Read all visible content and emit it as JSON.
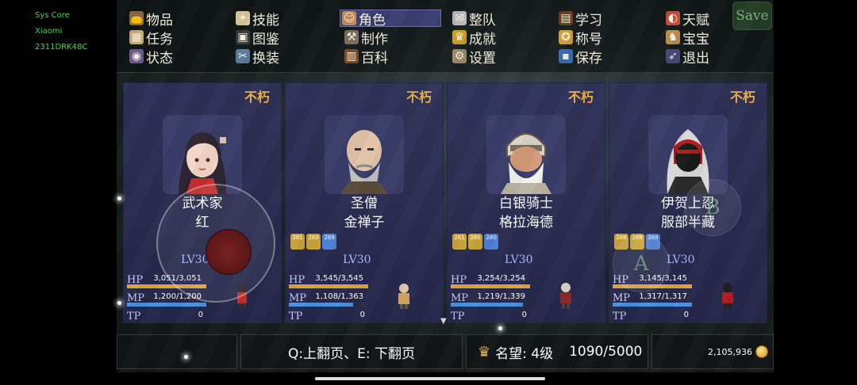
{
  "system": {
    "line1": "Sys Core",
    "line2": "Xiaomi",
    "line3": "2311DRK48C"
  },
  "menu": {
    "items": [
      {
        "label": "物品",
        "icon": "bag-icon"
      },
      {
        "label": "技能",
        "icon": "skill-icon"
      },
      {
        "label": "角色",
        "icon": "character-icon"
      },
      {
        "label": "整队",
        "icon": "formation-icon"
      },
      {
        "label": "学习",
        "icon": "book-icon"
      },
      {
        "label": "天赋",
        "icon": "talent-icon"
      },
      {
        "label": "任务",
        "icon": "quest-icon"
      },
      {
        "label": "图鉴",
        "icon": "codex-icon"
      },
      {
        "label": "制作",
        "icon": "craft-icon"
      },
      {
        "label": "成就",
        "icon": "trophy-icon"
      },
      {
        "label": "称号",
        "icon": "medal-icon"
      },
      {
        "label": "宝宝",
        "icon": "pet-icon"
      },
      {
        "label": "状态",
        "icon": "status-icon"
      },
      {
        "label": "换装",
        "icon": "outfit-icon"
      },
      {
        "label": "百科",
        "icon": "encyclopedia-icon"
      },
      {
        "label": "设置",
        "icon": "gear-icon"
      },
      {
        "label": "保存",
        "icon": "save-icon"
      },
      {
        "label": "退出",
        "icon": "exit-icon"
      }
    ],
    "active": "角色",
    "save_label": "Save"
  },
  "party": [
    {
      "title": "不朽",
      "class": "武术家",
      "name": "红",
      "badges": [],
      "lv_prefix": "LV",
      "lv": "30",
      "hp": "3,051/3,051",
      "mp": "1,200/1,200",
      "tp": "0",
      "hp_frac": 1.0,
      "mp_frac": 1.0
    },
    {
      "title": "不朽",
      "class": "圣僧",
      "name": "金禅子",
      "badges": [
        "281",
        "289",
        "289"
      ],
      "lv_prefix": "LV",
      "lv": "30",
      "hp": "3,545/3,545",
      "mp": "1,108/1,363",
      "tp": "0",
      "hp_frac": 1.0,
      "mp_frac": 0.81
    },
    {
      "title": "不朽",
      "class": "白银骑士",
      "name": "格拉海德",
      "badges": [
        "281",
        "280",
        "280"
      ],
      "lv_prefix": "LV",
      "lv": "30",
      "hp": "3,254/3,254",
      "mp": "1,219/1,339",
      "tp": "0",
      "hp_frac": 1.0,
      "mp_frac": 0.91
    },
    {
      "title": "不朽",
      "class": "伊贺上忍",
      "name": "服部半藏",
      "badges": [
        "288",
        "288",
        "288"
      ],
      "lv_prefix": "LV",
      "lv": "30",
      "hp": "3,145/3,145",
      "mp": "1,317/1,317",
      "tp": "0",
      "hp_frac": 1.0,
      "mp_frac": 1.0
    }
  ],
  "stat_labels": {
    "hp": "HP",
    "mp": "MP",
    "tp": "TP"
  },
  "bottom": {
    "page_hint": "Q:上翻页、E: 下翻页",
    "fame_label": "名望: 4级",
    "fame_progress": "1090/5000",
    "gold": "2,105,936"
  },
  "controls": {
    "a_label": "A",
    "b_label": "B"
  },
  "colors": {
    "hp_bar": "#e0a040",
    "mp_bar": "#4b8fe0",
    "title": "#e8b04a",
    "card_bg": "#30325c"
  }
}
